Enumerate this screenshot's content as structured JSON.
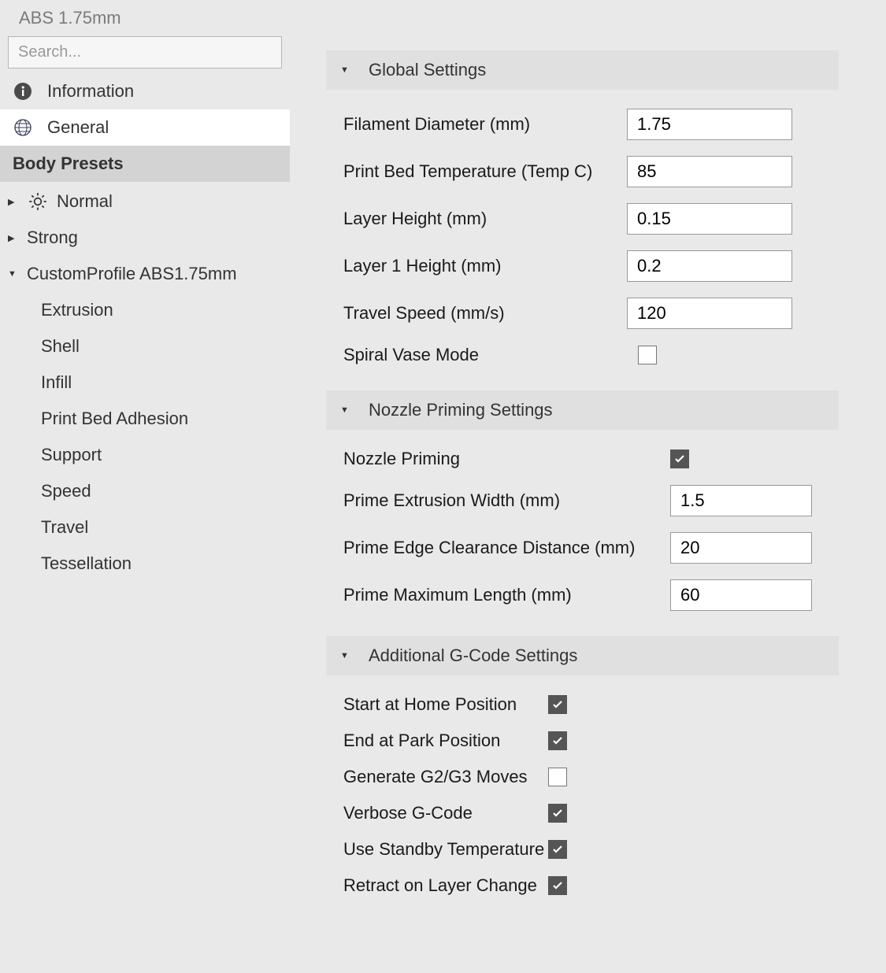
{
  "header": {
    "title": "ABS 1.75mm"
  },
  "search": {
    "placeholder": "Search..."
  },
  "nav": {
    "information": "Information",
    "general": "General"
  },
  "body_presets_header": "Body Presets",
  "presets": {
    "normal": "Normal",
    "strong": "Strong",
    "custom": "CustomProfile ABS1.75mm",
    "children": {
      "extrusion": "Extrusion",
      "shell": "Shell",
      "infill": "Infill",
      "adhesion": "Print Bed Adhesion",
      "support": "Support",
      "speed": "Speed",
      "travel": "Travel",
      "tessellation": "Tessellation"
    }
  },
  "groups": {
    "global": {
      "title": "Global Settings",
      "rows": {
        "filament_diameter": {
          "label": "Filament Diameter (mm)",
          "value": "1.75"
        },
        "bed_temp": {
          "label": "Print Bed Temperature (Temp C)",
          "value": "85"
        },
        "layer_height": {
          "label": "Layer Height (mm)",
          "value": "0.15"
        },
        "layer1_height": {
          "label": "Layer 1 Height (mm)",
          "value": "0.2"
        },
        "travel_speed": {
          "label": "Travel Speed (mm/s)",
          "value": "120"
        },
        "spiral_vase": {
          "label": "Spiral Vase Mode",
          "checked": false
        }
      }
    },
    "nozzle": {
      "title": "Nozzle Priming Settings",
      "rows": {
        "nozzle_priming": {
          "label": "Nozzle Priming",
          "checked": true
        },
        "prime_extrusion_width": {
          "label": "Prime Extrusion Width (mm)",
          "value": "1.5"
        },
        "prime_edge_clearance": {
          "label": "Prime Edge Clearance Distance (mm)",
          "value": "20"
        },
        "prime_max_length": {
          "label": "Prime Maximum Length (mm)",
          "value": "60"
        }
      }
    },
    "gcode": {
      "title": "Additional G-Code Settings",
      "rows": {
        "start_home": {
          "label": "Start at Home Position",
          "checked": true
        },
        "end_park": {
          "label": "End at Park Position",
          "checked": true
        },
        "g2g3": {
          "label": "Generate G2/G3 Moves",
          "checked": false
        },
        "verbose": {
          "label": "Verbose G-Code",
          "checked": true
        },
        "standby_temp": {
          "label": "Use Standby Temperature",
          "checked": true
        },
        "retract_layer": {
          "label": "Retract on Layer Change",
          "checked": true
        }
      }
    }
  }
}
